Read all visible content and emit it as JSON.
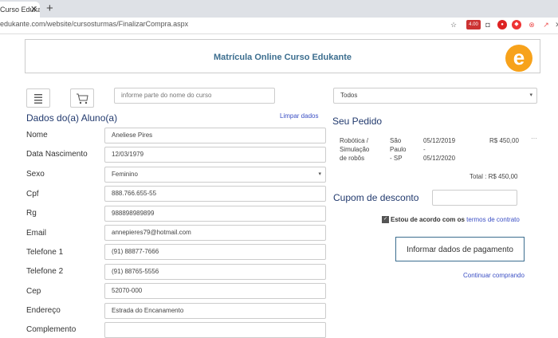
{
  "browser": {
    "tab_title": "Curso Edukante",
    "tab_close": "✕",
    "new_tab": "+",
    "url": "edukante.com/website/cursosturmas/FinalizarCompra.aspx",
    "ext_badge": "4.00"
  },
  "header": {
    "title": "Matrícula Online Curso Edukante",
    "logo_letter": "e"
  },
  "toolbar": {
    "search_placeholder": "informe parte do nome do curso",
    "filter_value": "Todos"
  },
  "student": {
    "section_title": "Dados do(a) Aluno(a)",
    "clear_link": "Limpar dados",
    "fields": [
      {
        "label": "Nome",
        "value": "Aneliese Pires"
      },
      {
        "label": "Data Nascimento",
        "value": "12/03/1979"
      },
      {
        "label": "Sexo",
        "value": "Feminino"
      },
      {
        "label": "Cpf",
        "value": "888.766.655-55"
      },
      {
        "label": "Rg",
        "value": "988898989899"
      },
      {
        "label": "Email",
        "value": "annepieres79@hotmail.com"
      },
      {
        "label": "Telefone 1",
        "value": "(91) 88877-7666"
      },
      {
        "label": "Telefone 2",
        "value": "(91) 88765-5556"
      },
      {
        "label": "Cep",
        "value": "52070-000"
      },
      {
        "label": "Endereço",
        "value": "Estrada do Encanamento"
      },
      {
        "label": "Complemento",
        "value": ""
      }
    ]
  },
  "order": {
    "section_title": "Seu Pedido",
    "item": {
      "course_line1": "Robótica /",
      "course_line2": "Simulação",
      "course_line3": "de robôs",
      "city_line1": "São",
      "city_line2": "Paulo",
      "city_line3": "- SP",
      "date_start": "05/12/2019",
      "date_sep": "-",
      "date_end": "05/12/2020",
      "price": "R$ 450,00"
    },
    "total_label": "Total : R$ 450,00",
    "coupon_label": "Cupom de desconto",
    "coupon_value": "",
    "agree_check": "✓",
    "agree_text": "Estou de acordo com os",
    "terms_link": "termos de contrato",
    "pay_button": "Informar dados de pagamento",
    "continue_link": "Continuar comprando"
  }
}
